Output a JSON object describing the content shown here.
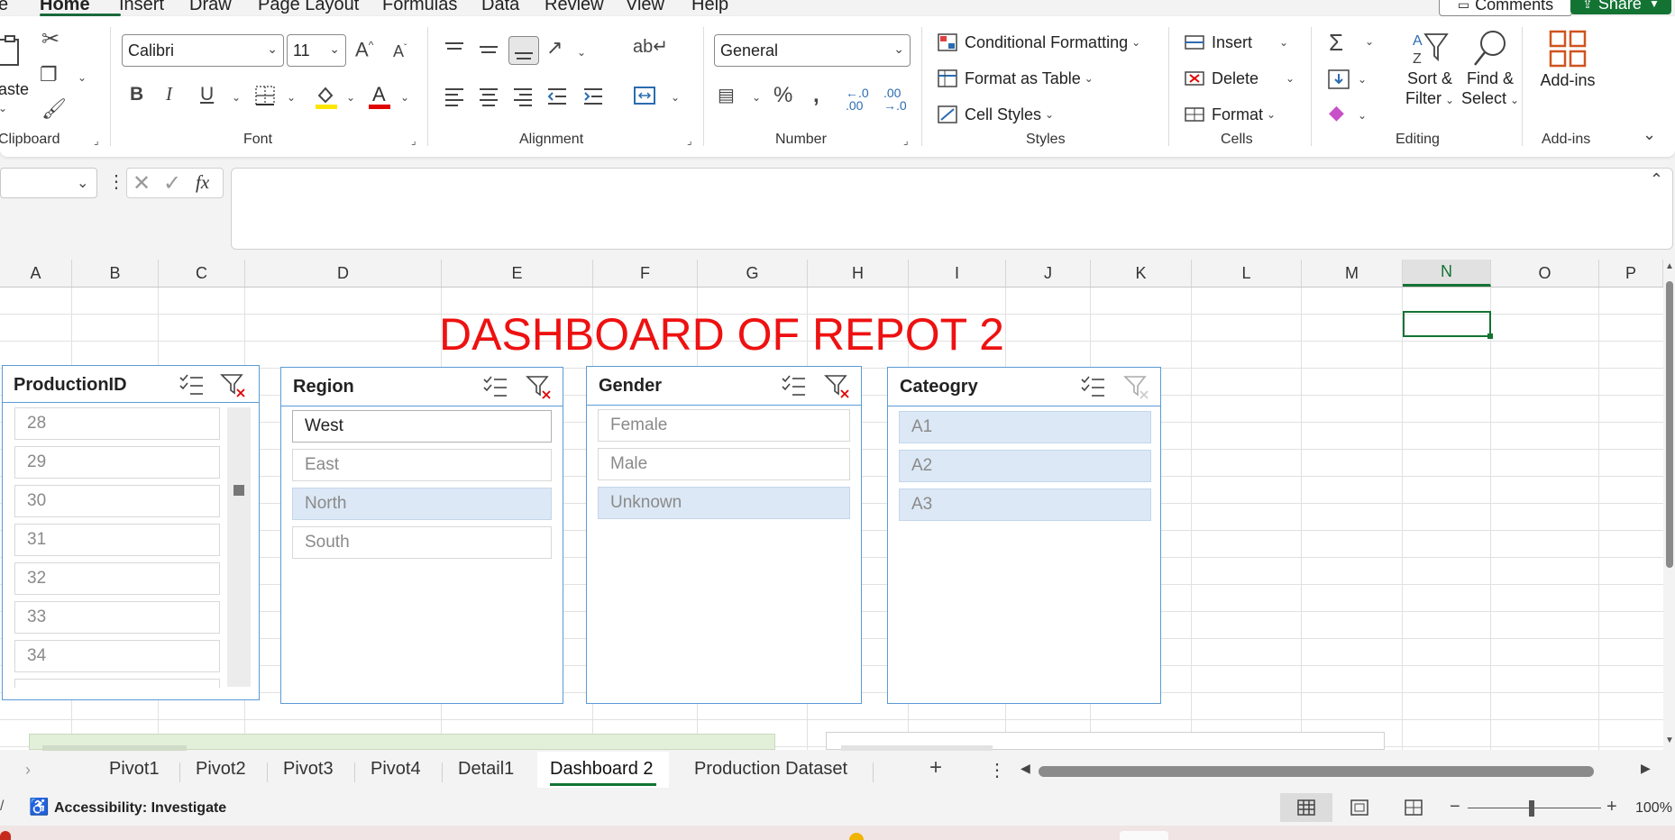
{
  "menu": {
    "tabs": [
      "e",
      "Home",
      "Insert",
      "Draw",
      "Page Layout",
      "Formulas",
      "Data",
      "Review",
      "View",
      "Help"
    ],
    "comments_label": "Comments",
    "share_label": "Share"
  },
  "ribbon": {
    "clipboard": {
      "paste_label": "aste",
      "group_label": "Clipboard"
    },
    "font": {
      "font_name": "Calibri",
      "font_size": "11",
      "group_label": "Font"
    },
    "alignment": {
      "group_label": "Alignment"
    },
    "number": {
      "format": "General",
      "group_label": "Number"
    },
    "styles": {
      "conditional_formatting": "Conditional Formatting",
      "format_as_table": "Format as Table",
      "cell_styles": "Cell Styles",
      "group_label": "Styles"
    },
    "cells": {
      "insert": "Insert",
      "delete": "Delete",
      "format": "Format",
      "group_label": "Cells"
    },
    "editing": {
      "sort_filter_line1": "Sort &",
      "sort_filter_line2": "Filter",
      "find_select_line1": "Find &",
      "find_select_line2": "Select",
      "group_label": "Editing"
    },
    "addins": {
      "label": "Add-ins",
      "group_label": "Add-ins"
    }
  },
  "formula_bar": {
    "name_box": "",
    "fx_label": "fx",
    "value": ""
  },
  "columns": [
    "A",
    "B",
    "C",
    "D",
    "E",
    "F",
    "G",
    "H",
    "I",
    "J",
    "K",
    "L",
    "M",
    "N",
    "O",
    "P"
  ],
  "selected_column": "N",
  "dashboard_title": "DASHBOARD OF REPOT 2",
  "slicers": {
    "production": {
      "title": "ProductionID",
      "items": [
        "28",
        "29",
        "30",
        "31",
        "32",
        "33",
        "34"
      ]
    },
    "region": {
      "title": "Region",
      "items": [
        "West",
        "East",
        "North",
        "South"
      ],
      "selected": "West"
    },
    "gender": {
      "title": "Gender",
      "items": [
        "Female",
        "Male",
        "Unknown"
      ]
    },
    "category": {
      "title": "Cateogry",
      "items": [
        "A1",
        "A2",
        "A3"
      ]
    }
  },
  "sheet_tabs": [
    "Pivot1",
    "Pivot2",
    "Pivot3",
    "Pivot4",
    "Detail1",
    "Dashboard 2",
    "Production Dataset"
  ],
  "active_sheet": "Dashboard 2",
  "status": {
    "accessibility": "Accessibility: Investigate",
    "zoom": "100%"
  },
  "colors": {
    "accent_green": "#137333",
    "title_red": "#ee1111",
    "slicer_border": "#5b9bd5"
  }
}
